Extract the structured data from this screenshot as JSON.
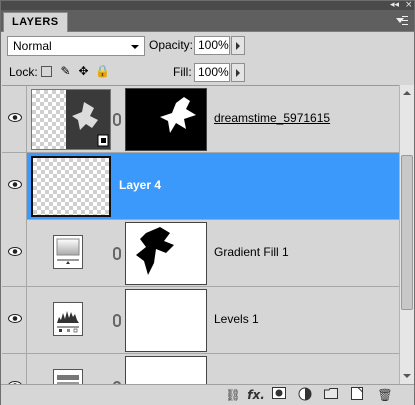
{
  "panel": {
    "tab_label": "LAYERS",
    "collapse_glyph": "◂◂",
    "close_glyph": "×"
  },
  "options": {
    "blend_mode": "Normal",
    "opacity_label": "Opacity:",
    "opacity_value": "100%",
    "lock_label": "Lock:",
    "fill_label": "Fill:",
    "fill_value": "100%"
  },
  "layers": [
    {
      "name": "dreamstime_5971615",
      "selected": false,
      "visible": true,
      "kind": "smart-object"
    },
    {
      "name": "Layer 4",
      "selected": true,
      "visible": true,
      "kind": "pixel"
    },
    {
      "name": "Gradient Fill 1",
      "selected": false,
      "visible": true,
      "kind": "gradient-fill"
    },
    {
      "name": "Levels 1",
      "selected": false,
      "visible": true,
      "kind": "levels"
    },
    {
      "name": "",
      "selected": false,
      "visible": true,
      "kind": "adjustment-partial"
    }
  ],
  "toolbar": {
    "icons": [
      "link-layers-icon",
      "fx-icon",
      "add-mask-icon",
      "adjustment-layer-icon",
      "group-folder-icon",
      "new-layer-icon",
      "trash-icon"
    ],
    "fx_label": "fx."
  },
  "colors": {
    "selection": "#3a99fb",
    "panel_bg": "#d6d6d6",
    "tab_bar": "#5f5f5f"
  }
}
